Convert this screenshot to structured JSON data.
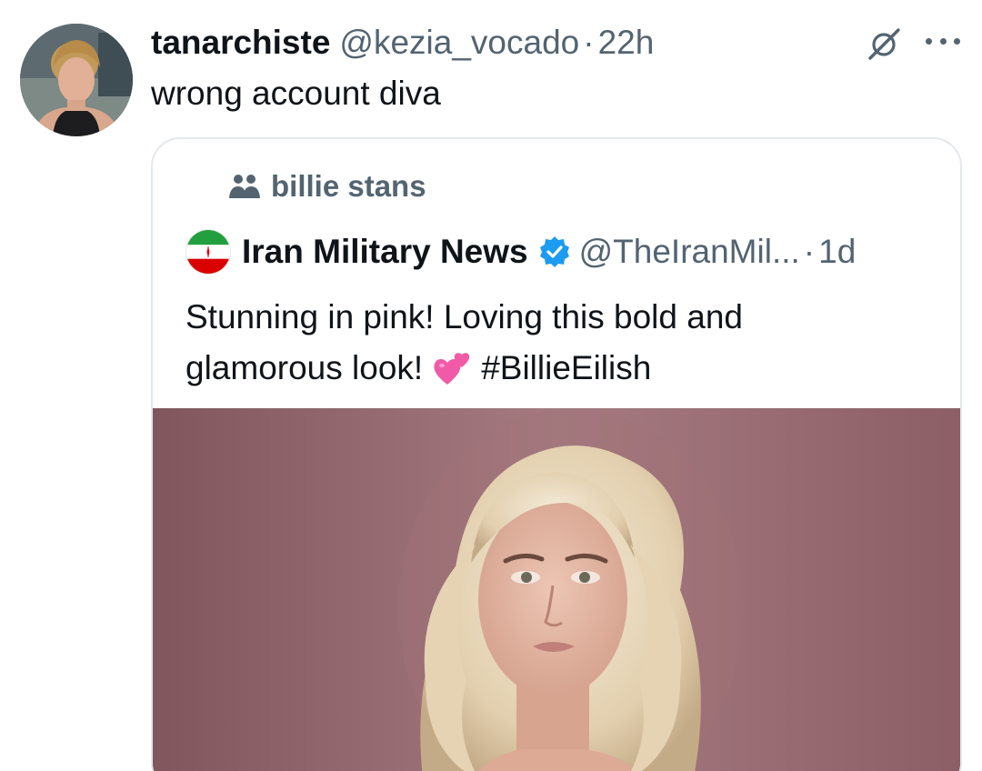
{
  "reply": {
    "display_name": "tanarchiste",
    "handle": "@kezia_vocado",
    "separator": "·",
    "time": "22h",
    "text": "wrong account diva",
    "avatar_icon": "user-avatar-photo",
    "grok_icon": "grok-icon",
    "more_icon": "more-options-icon"
  },
  "quote": {
    "community_icon": "community-icon",
    "community_name": "billie stans",
    "avatar_icon": "iran-flag-avatar",
    "display_name": "Iran Military News",
    "verified_icon": "verified-badge-icon",
    "handle": "@TheIranMil...",
    "separator": "·",
    "time": "1d",
    "text_line1": "Stunning in pink! Loving this bold and",
    "text_line2_prefix": "glamorous look!",
    "emoji_icon": "two-hearts-emoji",
    "hashtag": "#BillieEilish",
    "media": "photo-of-blonde-woman-on-pink-background"
  },
  "colors": {
    "primary_text": "#0f1419",
    "secondary_text": "#536471",
    "border": "#e3e8ec",
    "verified_blue": "#1d9bf0",
    "media_background": "#8a5c63"
  }
}
